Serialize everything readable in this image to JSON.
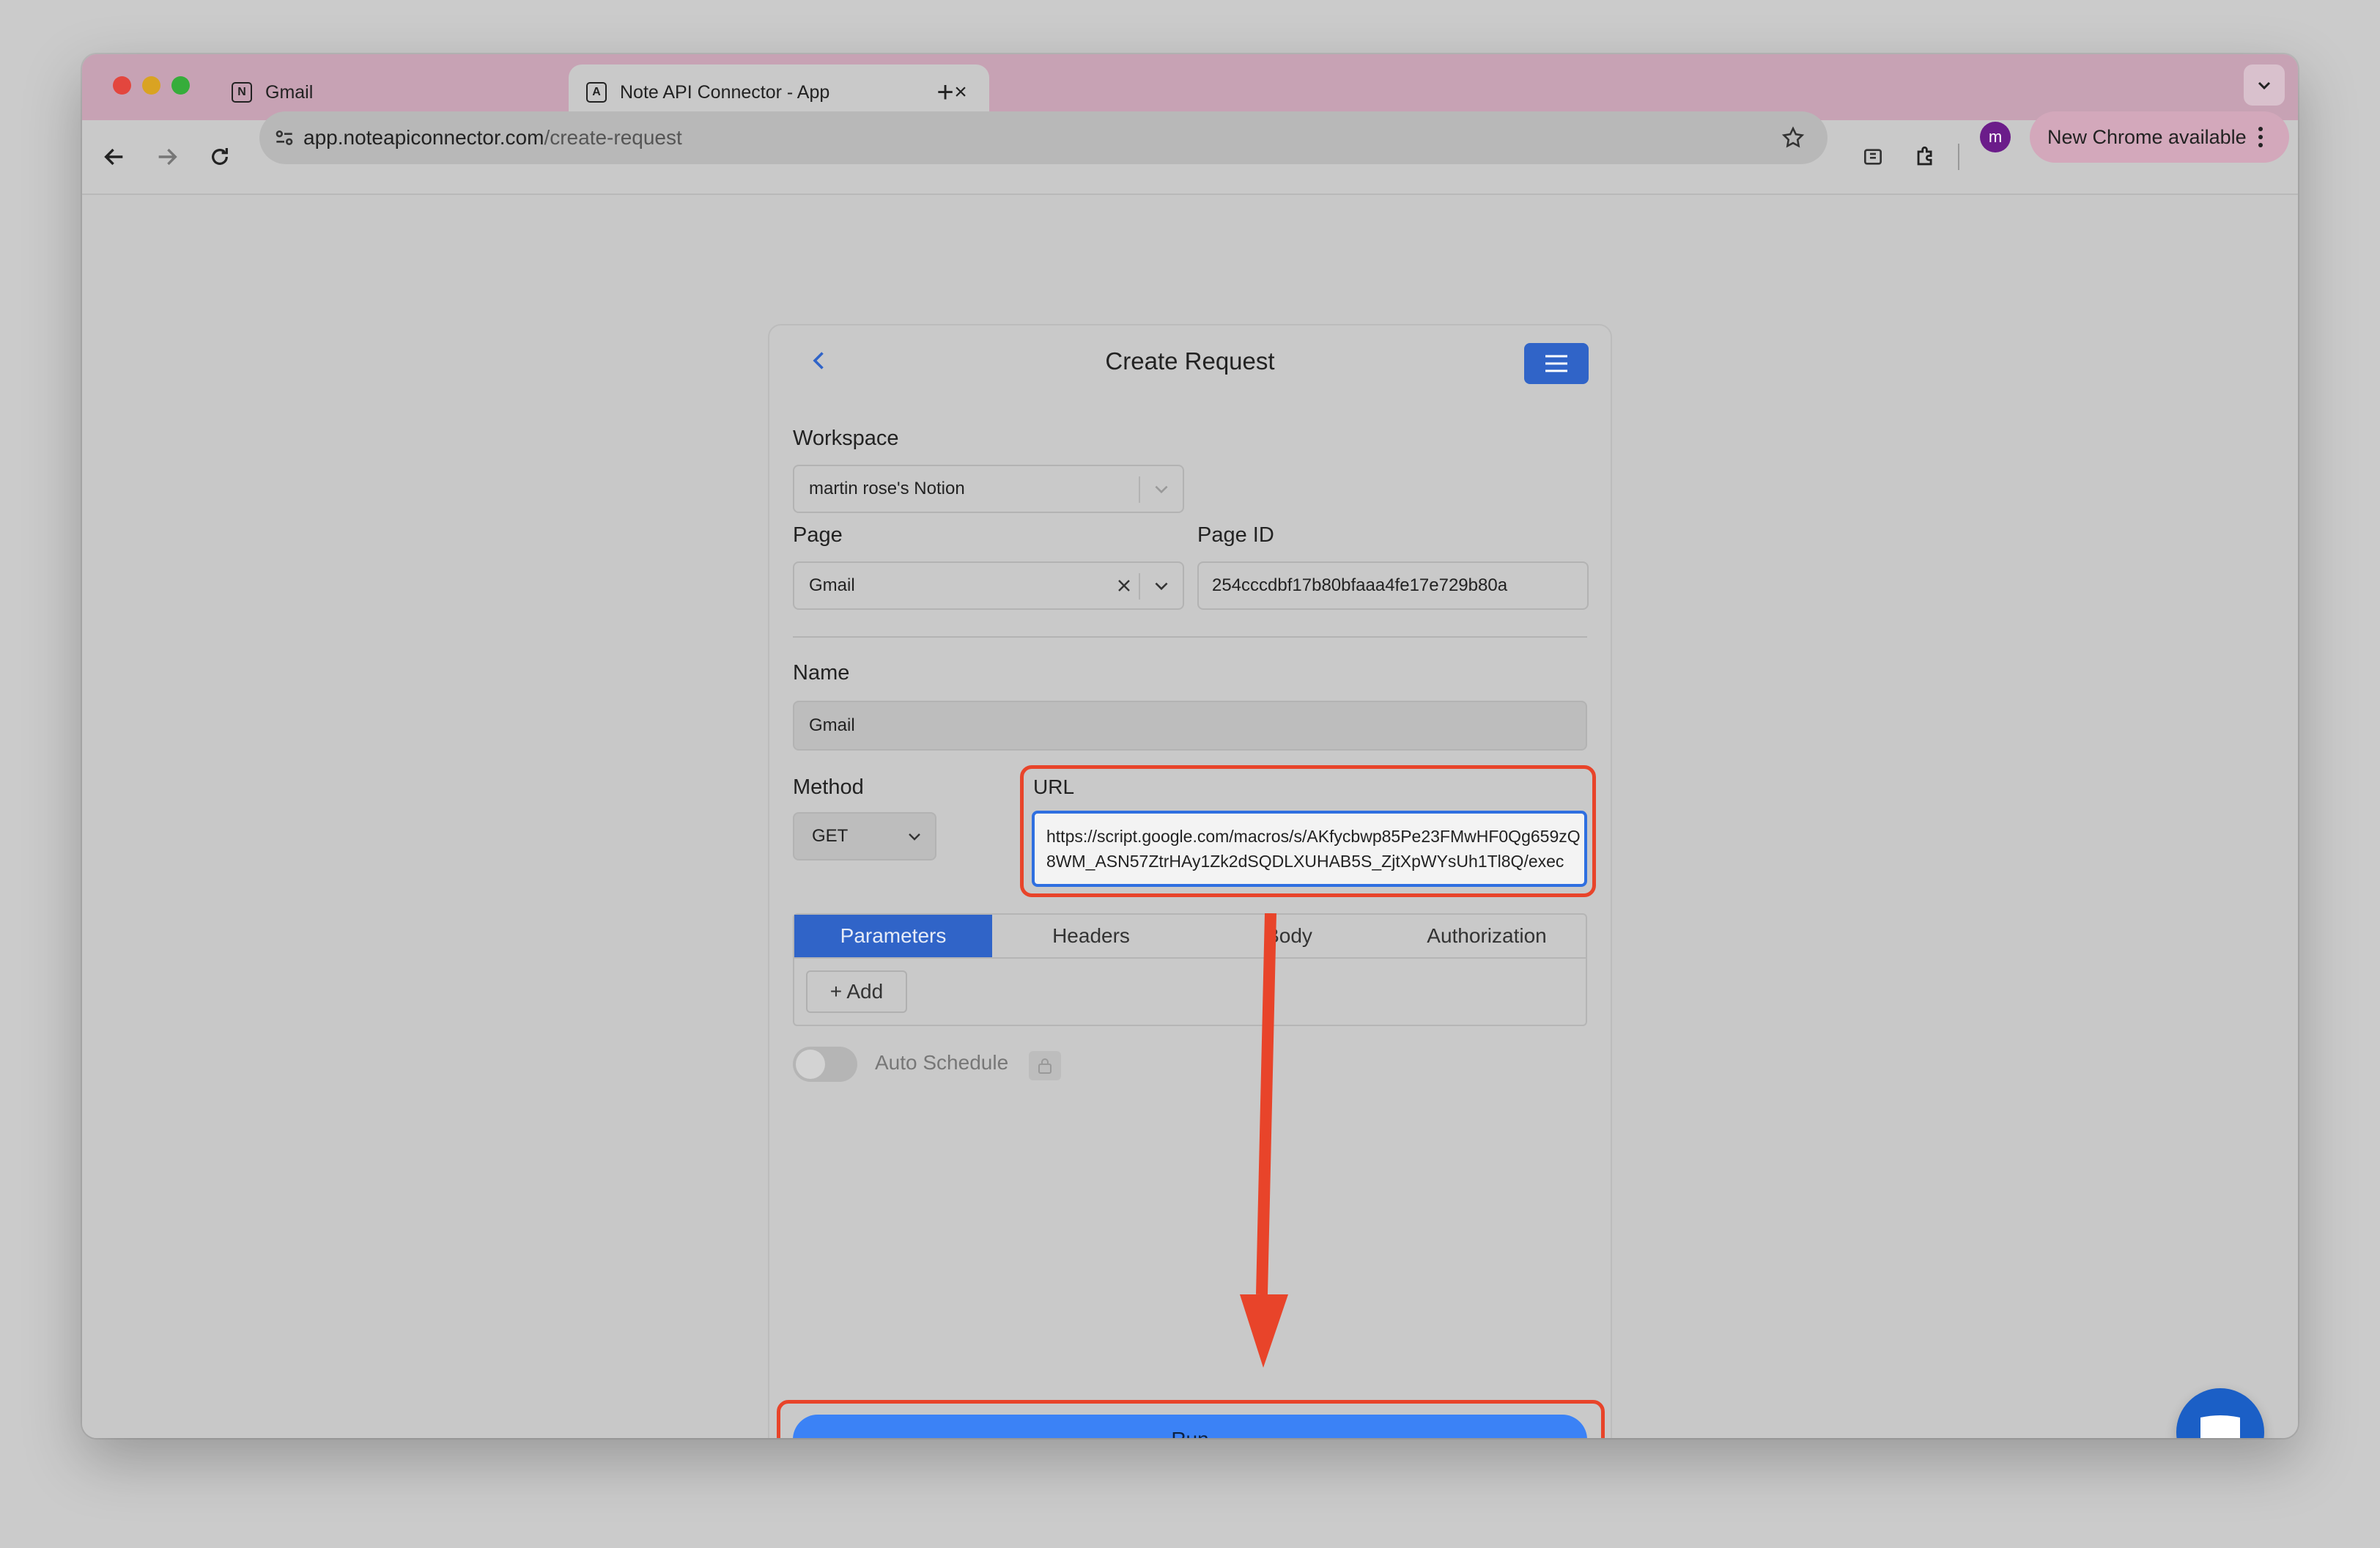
{
  "browser": {
    "tabs": [
      {
        "title": "Gmail",
        "favicon": "N",
        "active": false
      },
      {
        "title": "Note API Connector - App",
        "favicon": "A",
        "active": true
      }
    ],
    "url_domain": "app.noteapiconnector.com",
    "url_path": "/create-request",
    "chrome_update": "New Chrome available",
    "profile_initial": "m"
  },
  "page": {
    "title": "Create Request",
    "workspace": {
      "label": "Workspace",
      "value": "martin rose's Notion"
    },
    "page": {
      "label": "Page",
      "value": "Gmail"
    },
    "page_id": {
      "label": "Page ID",
      "value": "254cccdbf17b80bfaaa4fe17e729b80a"
    },
    "name": {
      "label": "Name",
      "value": "Gmail"
    },
    "method": {
      "label": "Method",
      "value": "GET"
    },
    "url": {
      "label": "URL",
      "line1": "https://script.google.com/macros/s/AKfycbwp85Pe23FMwHF0Qg659zQ",
      "line2": "8WM_ASN57ZtrHAy1Zk2dSQDLXUHAB5S_ZjtXpWYsUh1Tl8Q/exec"
    },
    "tabs": [
      "Parameters",
      "Headers",
      "Body",
      "Authorization"
    ],
    "add_label": "+ Add",
    "auto_schedule": "Auto Schedule",
    "run_label": "Run"
  },
  "colors": {
    "accent": "#3064c8",
    "run": "#3b82f6",
    "highlight": "#e8442a"
  }
}
